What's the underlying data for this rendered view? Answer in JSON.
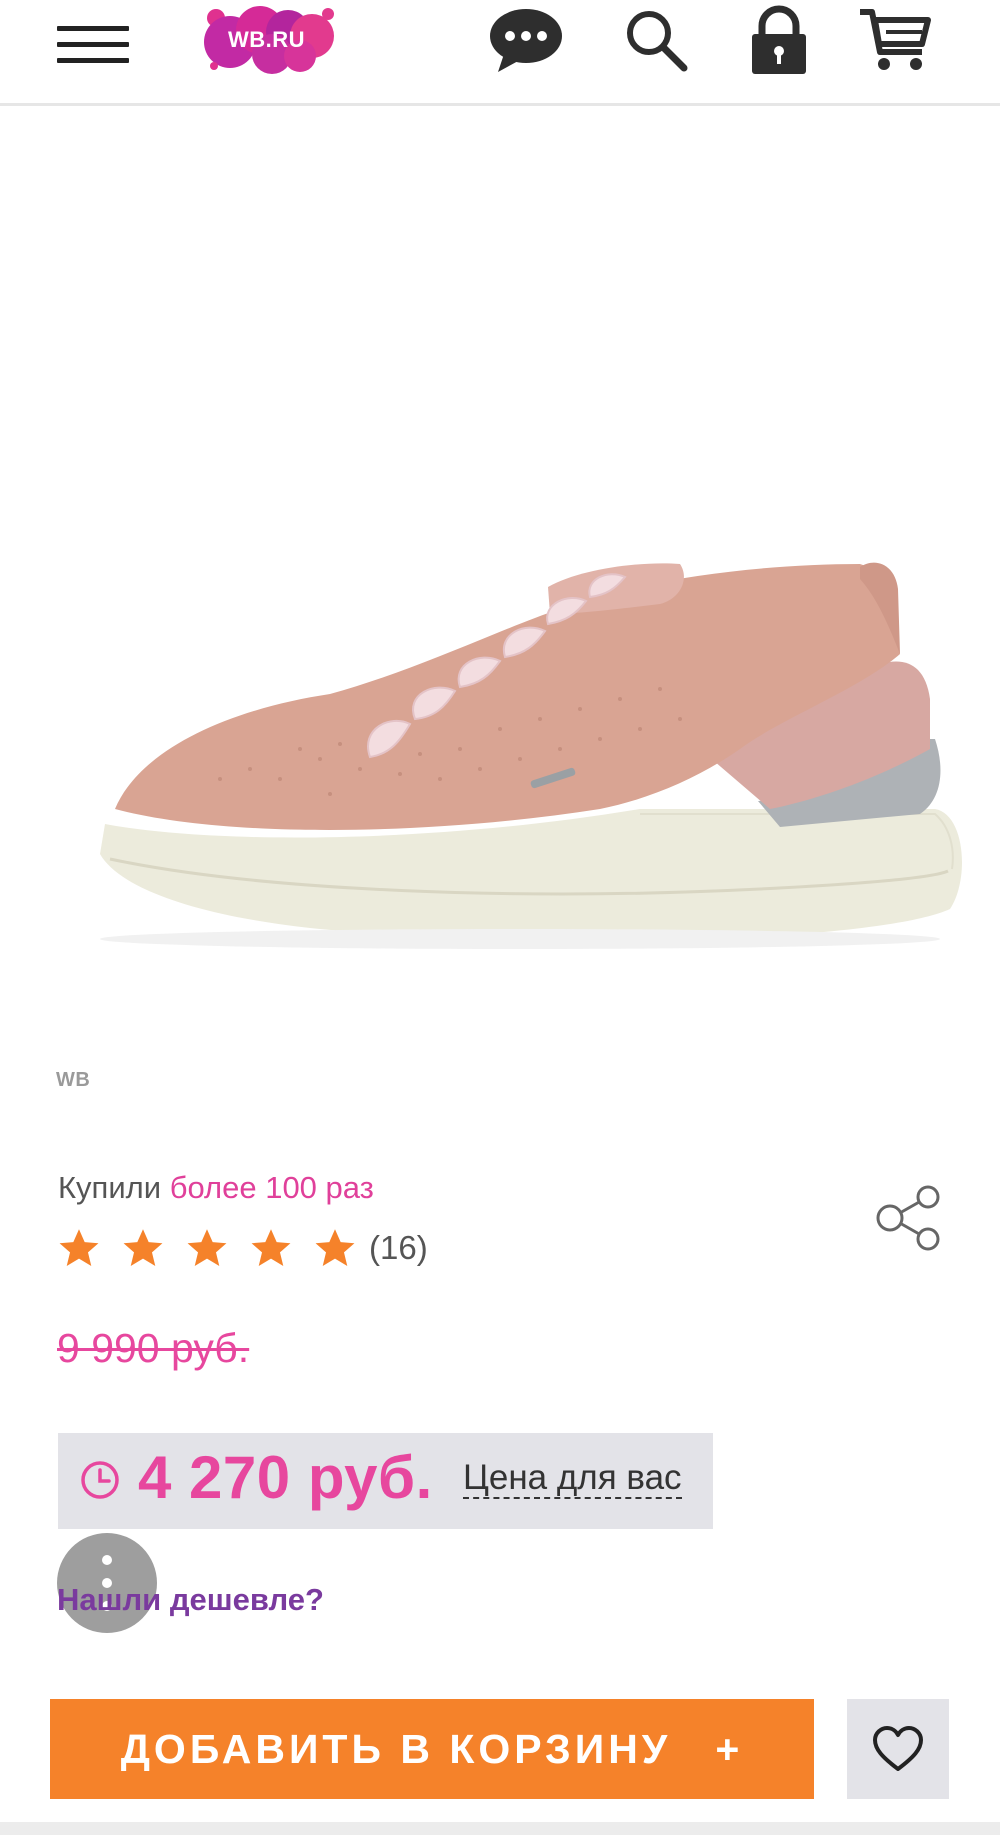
{
  "header": {
    "logo_text": "WB.RU",
    "icons": [
      "menu-icon",
      "chat-icon",
      "search-icon",
      "lock-icon",
      "cart-icon"
    ]
  },
  "product": {
    "image_watermark": "WB",
    "bought_prefix": "Купили",
    "bought_accent": "более 100 раз",
    "rating_stars": 5,
    "reviews_count": "(16)",
    "old_price": "9 990 руб.",
    "price": "4 270 руб.",
    "price_for_you": "Цена для вас",
    "found_cheaper": "Нашли дешевле?"
  },
  "actions": {
    "add_to_cart": "ДОБАВИТЬ В КОРЗИНУ",
    "add_plus": "+"
  },
  "colors": {
    "accent_pink": "#e7479e",
    "purple_link": "#7a3a9e",
    "cart_orange": "#f5822a",
    "star_orange": "#f5822a"
  }
}
